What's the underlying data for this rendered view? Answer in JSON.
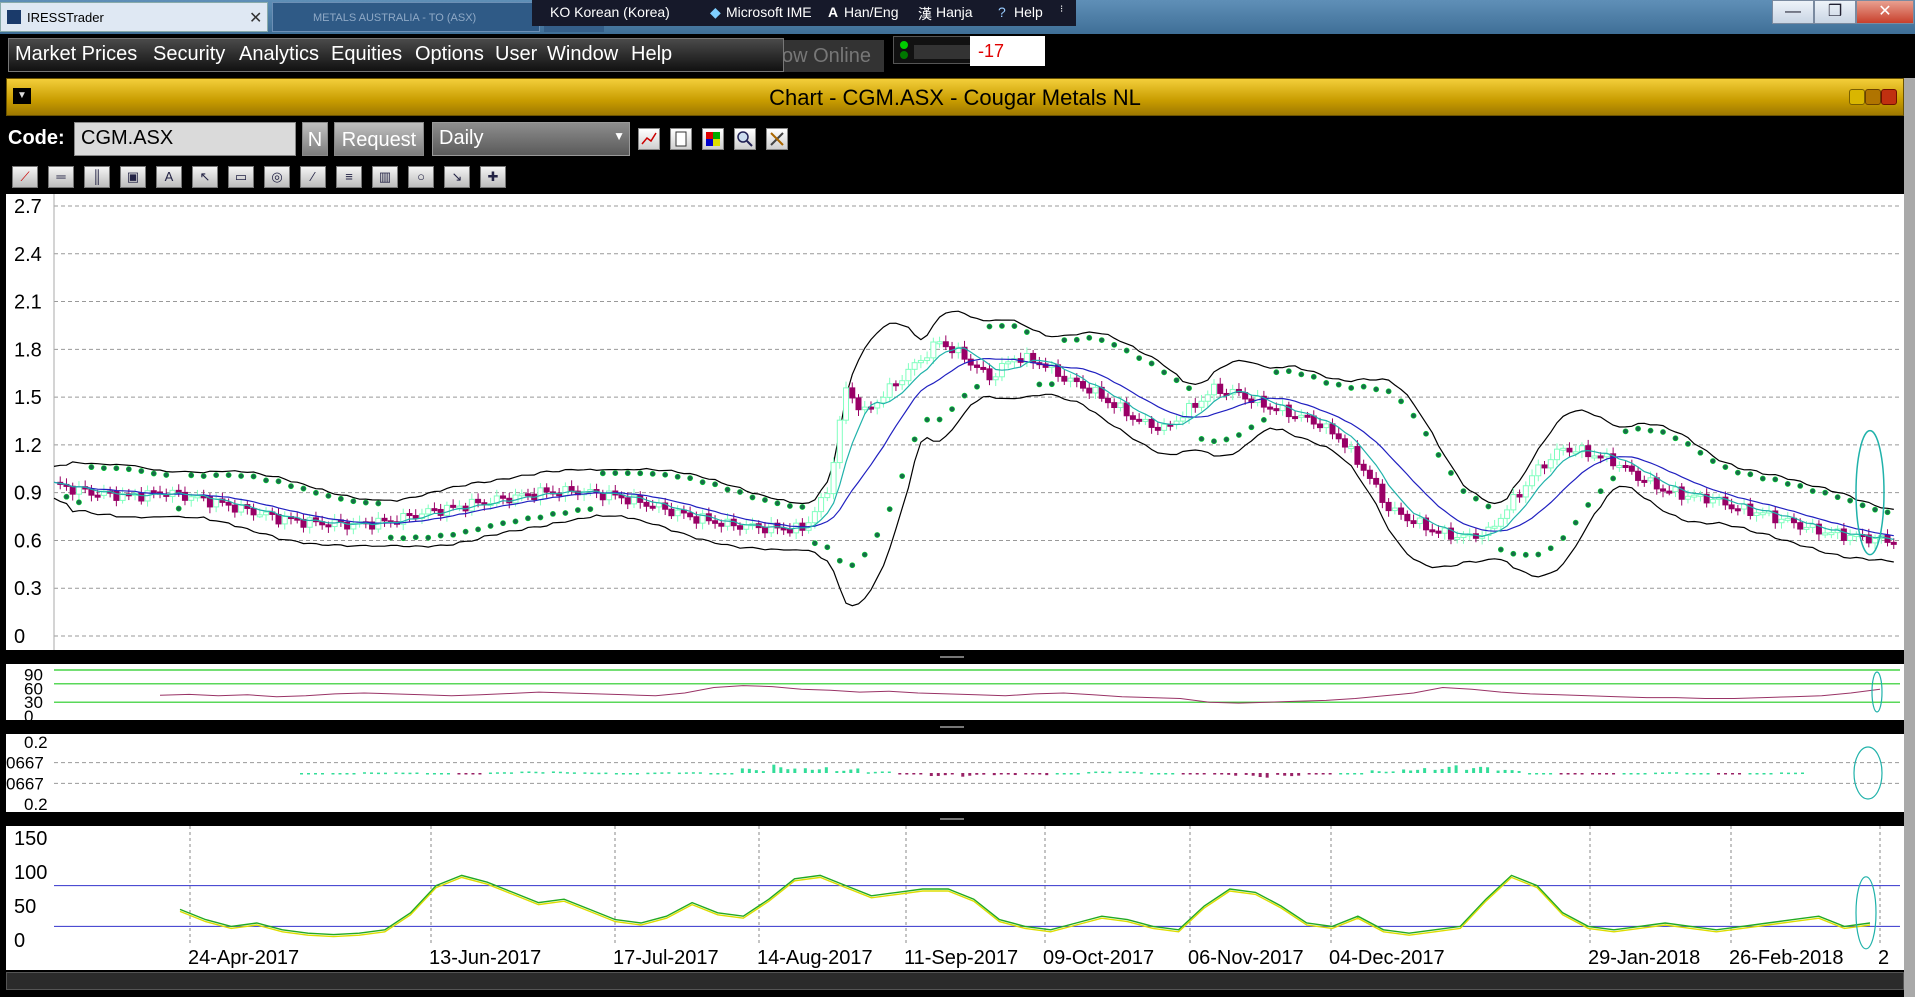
{
  "window": {
    "app_title": "IRESSTrader",
    "tab2_title": "METALS AUSTRALIA - TO (ASX)",
    "minimize_glyph": "—",
    "restore_glyph": "❒",
    "close_glyph": "✕",
    "tab_close_glyph": "✕"
  },
  "ime_bar": {
    "language": "KO Korean (Korea)",
    "ime_name": "Microsoft IME",
    "han_eng": "Han/Eng",
    "hanja": "Hanja",
    "help": "Help"
  },
  "menu": [
    "Market Prices",
    "Security",
    "Analytics",
    "Equities",
    "Options",
    "User",
    "Window",
    "Help"
  ],
  "online_status": "ow Online",
  "counter": "-17",
  "chart_window": {
    "title": "Chart - CGM.ASX - Cougar Metals NL"
  },
  "controls": {
    "code_label": "Code:",
    "code_value": "CGM.ASX",
    "n_button": "N",
    "request_button": "Request",
    "interval": "Daily"
  },
  "toolbar_icons": [
    "line-chart-icon",
    "page-icon",
    "color-palette-icon",
    "zoom-icon",
    "tools-icon"
  ],
  "drawing_tools": [
    "trend-line-icon",
    "horizontal-line-icon",
    "vertical-line-icon",
    "zoom-box-icon",
    "text-tool-icon",
    "pointer-icon",
    "rectangle-icon",
    "ellipse-box-icon",
    "diagonal-icon",
    "fib-icon",
    "period-icon",
    "circle-icon",
    "arrow-line-icon",
    "crosshair-icon"
  ],
  "colors": {
    "candle_up": "#80ffbf",
    "candle_down": "#990066",
    "bollinger": "#000000",
    "ma_blue": "#2020c0",
    "ma_cyan": "#20b2aa",
    "psar": "#1a6b4a",
    "rsi_line": "#993366",
    "stoch_green": "#22aa22",
    "stoch_yellow": "#dddd00"
  },
  "chart_data": [
    {
      "type": "candlestick",
      "yticks": [
        "2.7",
        "2.4",
        "2.1",
        "1.8",
        "1.5",
        "1.2",
        "0.9",
        "0.6",
        "0.3",
        "0"
      ],
      "ylim": [
        0,
        2.7
      ],
      "grid": "horizontal dashed",
      "close_points": [
        [
          0,
          0.95
        ],
        [
          6,
          0.9
        ],
        [
          12,
          0.88
        ],
        [
          18,
          0.9
        ],
        [
          24,
          0.86
        ],
        [
          30,
          0.8
        ],
        [
          36,
          0.74
        ],
        [
          42,
          0.71
        ],
        [
          48,
          0.7
        ],
        [
          54,
          0.72
        ],
        [
          60,
          0.78
        ],
        [
          66,
          0.82
        ],
        [
          72,
          0.86
        ],
        [
          78,
          0.9
        ],
        [
          84,
          0.91
        ],
        [
          90,
          0.88
        ],
        [
          96,
          0.82
        ],
        [
          102,
          0.75
        ],
        [
          108,
          0.7
        ],
        [
          114,
          0.68
        ],
        [
          120,
          0.67
        ],
        [
          124,
          0.9
        ],
        [
          127,
          1.55
        ],
        [
          130,
          1.4
        ],
        [
          134,
          1.55
        ],
        [
          138,
          1.7
        ],
        [
          142,
          1.85
        ],
        [
          146,
          1.75
        ],
        [
          150,
          1.62
        ],
        [
          154,
          1.75
        ],
        [
          158,
          1.72
        ],
        [
          162,
          1.62
        ],
        [
          166,
          1.55
        ],
        [
          170,
          1.45
        ],
        [
          174,
          1.35
        ],
        [
          178,
          1.3
        ],
        [
          182,
          1.42
        ],
        [
          186,
          1.55
        ],
        [
          190,
          1.52
        ],
        [
          194,
          1.45
        ],
        [
          198,
          1.4
        ],
        [
          202,
          1.35
        ],
        [
          206,
          1.25
        ],
        [
          210,
          1.05
        ],
        [
          214,
          0.8
        ],
        [
          218,
          0.72
        ],
        [
          222,
          0.65
        ],
        [
          226,
          0.62
        ],
        [
          230,
          0.65
        ],
        [
          234,
          0.85
        ],
        [
          238,
          1.05
        ],
        [
          242,
          1.18
        ],
        [
          246,
          1.15
        ],
        [
          250,
          1.1
        ],
        [
          254,
          1.0
        ],
        [
          258,
          0.92
        ],
        [
          262,
          0.88
        ],
        [
          266,
          0.86
        ],
        [
          270,
          0.8
        ],
        [
          274,
          0.77
        ],
        [
          278,
          0.72
        ],
        [
          282,
          0.67
        ],
        [
          286,
          0.64
        ],
        [
          290,
          0.62
        ],
        [
          294,
          0.6
        ]
      ],
      "annotation": "cyan ellipse highlighting latest bars"
    },
    {
      "type": "line",
      "name": "RSI panel",
      "yticks": [
        "90",
        "60",
        "30",
        "0"
      ],
      "ylim": [
        0,
        100
      ],
      "reference_lines": [
        30,
        70
      ],
      "values": [
        45,
        47,
        44,
        46,
        42,
        44,
        48,
        50,
        48,
        46,
        44,
        46,
        49,
        52,
        50,
        48,
        46,
        44,
        50,
        62,
        66,
        64,
        58,
        56,
        52,
        54,
        50,
        48,
        46,
        44,
        48,
        50,
        46,
        42,
        40,
        38,
        30,
        28,
        30,
        32,
        34,
        38,
        44,
        50,
        62,
        58,
        52,
        48,
        46,
        44,
        42,
        40,
        40,
        38,
        38,
        40,
        42,
        44,
        50,
        58
      ]
    },
    {
      "type": "histogram",
      "name": "MACD panel",
      "yticks": [
        "0.2",
        "0667",
        "0667",
        "0.2"
      ],
      "ylim": [
        -0.2,
        0.2
      ],
      "values": [
        0,
        0,
        0.005,
        0.005,
        0,
        -0.005,
        0.005,
        0.01,
        0.01,
        0.005,
        0,
        0.005,
        0.005,
        0,
        0.03,
        0.06,
        0.05,
        0.03,
        0.01,
        -0.01,
        -0.02,
        -0.025,
        -0.02,
        -0.015,
        0,
        0.01,
        0.01,
        0,
        -0.01,
        -0.02,
        -0.03,
        -0.02,
        -0.01,
        0,
        0.02,
        0.04,
        0.05,
        0.04,
        0.02,
        0,
        -0.005,
        -0.01,
        0,
        0.005,
        0,
        -0.005,
        0,
        0.005
      ]
    },
    {
      "type": "line",
      "name": "Stochastic panel",
      "yticks": [
        "150",
        "100",
        "50",
        "0"
      ],
      "ylim": [
        0,
        150
      ],
      "reference_lines": [
        20,
        80
      ],
      "x_tick_labels": [
        "24-Apr-2017",
        "13-Jun-2017",
        "17-Jul-2017",
        "14-Aug-2017",
        "11-Sep-2017",
        "09-Oct-2017",
        "06-Nov-2017",
        "04-Dec-2017",
        "29-Jan-2018",
        "26-Feb-2018",
        "2"
      ],
      "values": [
        45,
        30,
        20,
        25,
        15,
        10,
        8,
        10,
        15,
        40,
        80,
        95,
        85,
        70,
        55,
        60,
        45,
        30,
        25,
        35,
        55,
        40,
        35,
        60,
        90,
        95,
        80,
        65,
        70,
        75,
        75,
        60,
        30,
        20,
        15,
        25,
        35,
        30,
        20,
        15,
        50,
        75,
        70,
        50,
        25,
        20,
        35,
        15,
        10,
        15,
        20,
        60,
        95,
        80,
        40,
        20,
        15,
        20,
        25,
        20,
        15,
        20,
        25,
        30,
        35,
        20,
        25
      ]
    }
  ]
}
